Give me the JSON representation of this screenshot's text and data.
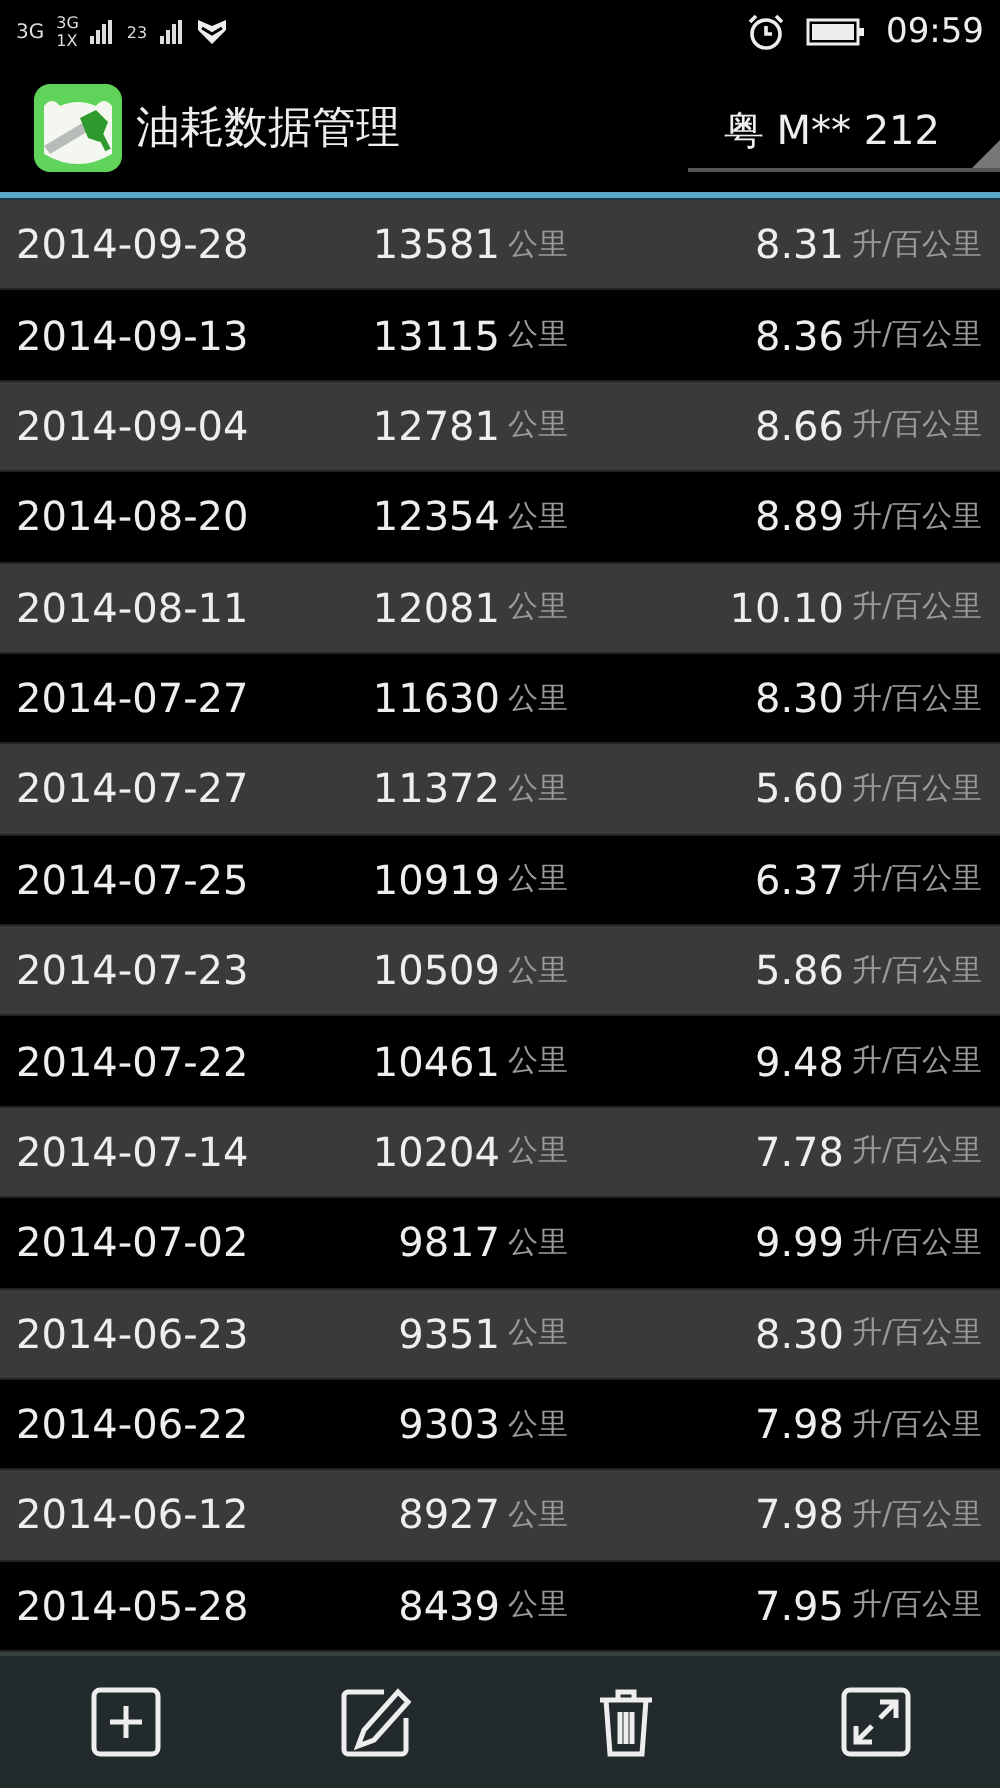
{
  "status_bar": {
    "network": "3G",
    "sim1": "3G",
    "sim1b": "1X",
    "sim2": "23",
    "time": "09:59"
  },
  "header": {
    "title": "油耗数据管理",
    "vehicle": "粤 M** 212"
  },
  "records": [
    {
      "date": "2014-09-28",
      "km": "13581",
      "km_unit": "公里",
      "consumption": "8.31",
      "consumption_unit": "升/百公里"
    },
    {
      "date": "2014-09-13",
      "km": "13115",
      "km_unit": "公里",
      "consumption": "8.36",
      "consumption_unit": "升/百公里"
    },
    {
      "date": "2014-09-04",
      "km": "12781",
      "km_unit": "公里",
      "consumption": "8.66",
      "consumption_unit": "升/百公里"
    },
    {
      "date": "2014-08-20",
      "km": "12354",
      "km_unit": "公里",
      "consumption": "8.89",
      "consumption_unit": "升/百公里"
    },
    {
      "date": "2014-08-11",
      "km": "12081",
      "km_unit": "公里",
      "consumption": "10.10",
      "consumption_unit": "升/百公里"
    },
    {
      "date": "2014-07-27",
      "km": "11630",
      "km_unit": "公里",
      "consumption": "8.30",
      "consumption_unit": "升/百公里"
    },
    {
      "date": "2014-07-27",
      "km": "11372",
      "km_unit": "公里",
      "consumption": "5.60",
      "consumption_unit": "升/百公里"
    },
    {
      "date": "2014-07-25",
      "km": "10919",
      "km_unit": "公里",
      "consumption": "6.37",
      "consumption_unit": "升/百公里"
    },
    {
      "date": "2014-07-23",
      "km": "10509",
      "km_unit": "公里",
      "consumption": "5.86",
      "consumption_unit": "升/百公里"
    },
    {
      "date": "2014-07-22",
      "km": "10461",
      "km_unit": "公里",
      "consumption": "9.48",
      "consumption_unit": "升/百公里"
    },
    {
      "date": "2014-07-14",
      "km": "10204",
      "km_unit": "公里",
      "consumption": "7.78",
      "consumption_unit": "升/百公里"
    },
    {
      "date": "2014-07-02",
      "km": "9817",
      "km_unit": "公里",
      "consumption": "9.99",
      "consumption_unit": "升/百公里"
    },
    {
      "date": "2014-06-23",
      "km": "9351",
      "km_unit": "公里",
      "consumption": "8.30",
      "consumption_unit": "升/百公里"
    },
    {
      "date": "2014-06-22",
      "km": "9303",
      "km_unit": "公里",
      "consumption": "7.98",
      "consumption_unit": "升/百公里"
    },
    {
      "date": "2014-06-12",
      "km": "8927",
      "km_unit": "公里",
      "consumption": "7.98",
      "consumption_unit": "升/百公里"
    },
    {
      "date": "2014-05-28",
      "km": "8439",
      "km_unit": "公里",
      "consumption": "7.95",
      "consumption_unit": "升/百公里"
    }
  ],
  "toolbar": [
    {
      "kind": "add"
    },
    {
      "kind": "edit"
    },
    {
      "kind": "delete"
    },
    {
      "kind": "expand"
    }
  ]
}
